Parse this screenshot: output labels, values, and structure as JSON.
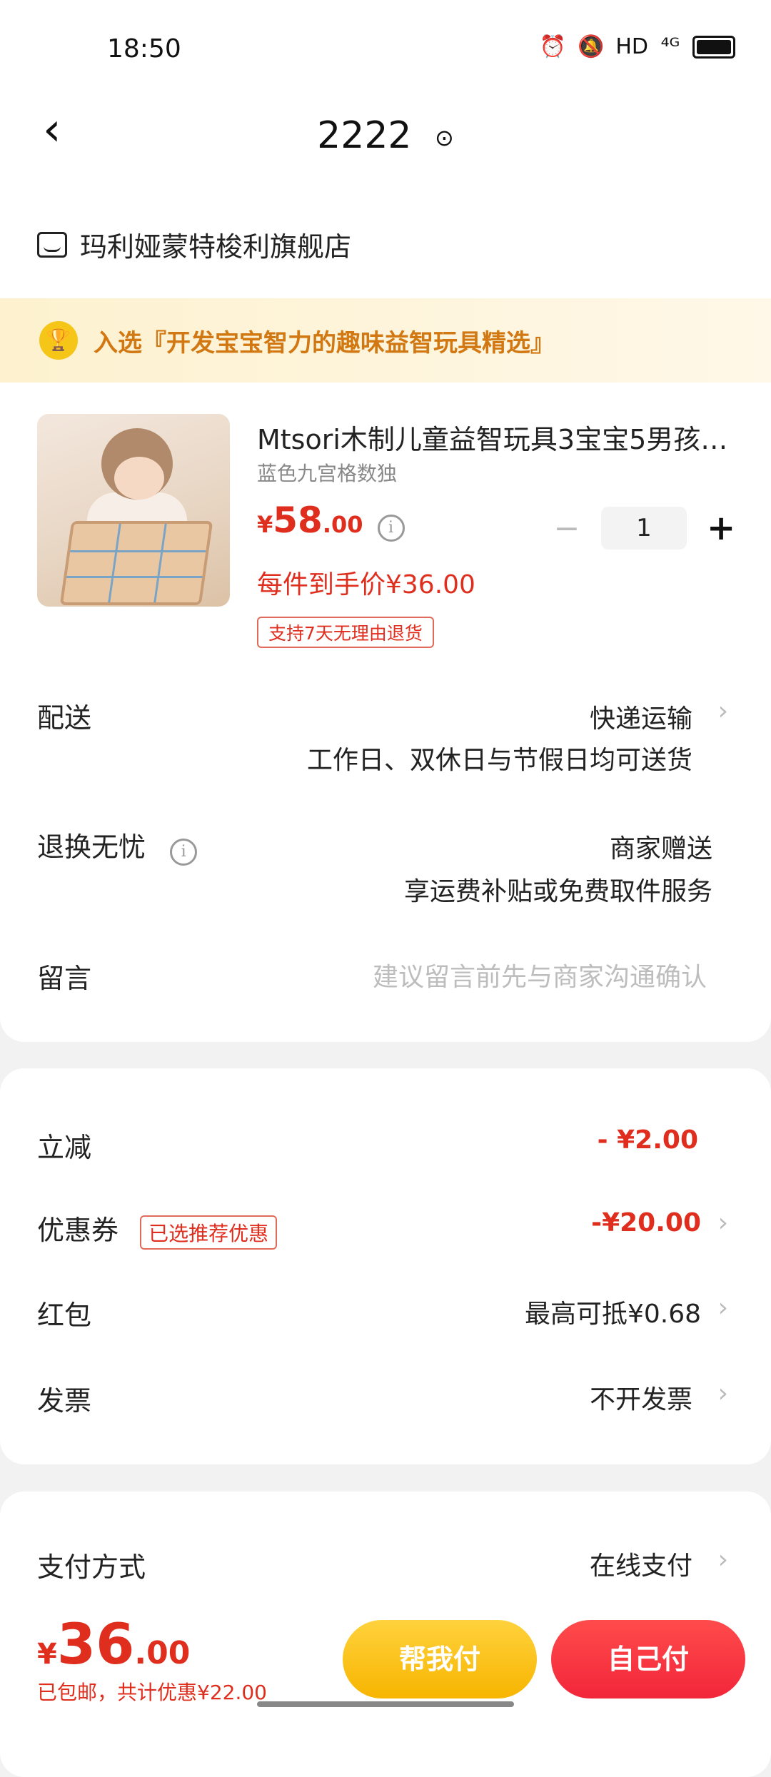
{
  "status_bar": {
    "time": "18:50",
    "icons": [
      "alarm-icon",
      "mute-icon",
      "hd-icon",
      "signal-4g-icon",
      "battery-icon"
    ],
    "hd_label": "HD",
    "network_label": "⁴ᴳ"
  },
  "nav": {
    "back_glyph": "‹",
    "title": "2222",
    "location_glyph": "⊙"
  },
  "shop": {
    "name": "玛利娅蒙特梭利旗舰店"
  },
  "banner": {
    "text": "入选『开发宝宝智力的趣味益智玩具精选』",
    "icon_glyph": "🏆"
  },
  "product": {
    "title": "Mtsori木制儿童益智玩具3宝宝5男孩…",
    "spec": "蓝色九宫格数独",
    "price_symbol": "¥",
    "price_int": "58",
    "price_dec": ".00",
    "info_glyph": "i",
    "final_price_text": "每件到手价¥36.00",
    "return_badge": "支持7天无理由退货",
    "quantity": "1",
    "minus_glyph": "−",
    "plus_glyph": "+"
  },
  "delivery": {
    "label": "配送",
    "value": "快递运输",
    "sub": "工作日、双休日与节假日均可送货"
  },
  "returns": {
    "label": "退换无忧",
    "value": "商家赠送",
    "sub": "享运费补贴或免费取件服务"
  },
  "message": {
    "label": "留言",
    "placeholder": "建议留言前先与商家沟通确认"
  },
  "discounts": {
    "instant": {
      "label": "立减",
      "value": "- ¥2.00"
    },
    "coupon": {
      "label": "优惠券",
      "tag": "已选推荐优惠",
      "value": "-¥20.00"
    },
    "red_packet": {
      "label": "红包",
      "value": "最高可抵¥0.68"
    },
    "invoice": {
      "label": "发票",
      "value": "不开发票"
    }
  },
  "payment": {
    "label": "支付方式",
    "value": "在线支付"
  },
  "chevron_glyph": "›",
  "bottom": {
    "total_symbol": "¥",
    "total_int": "36",
    "total_dec": ".00",
    "note": "已包邮，共计优惠¥22.00",
    "help_pay": "帮我付",
    "self_pay": "自己付"
  }
}
